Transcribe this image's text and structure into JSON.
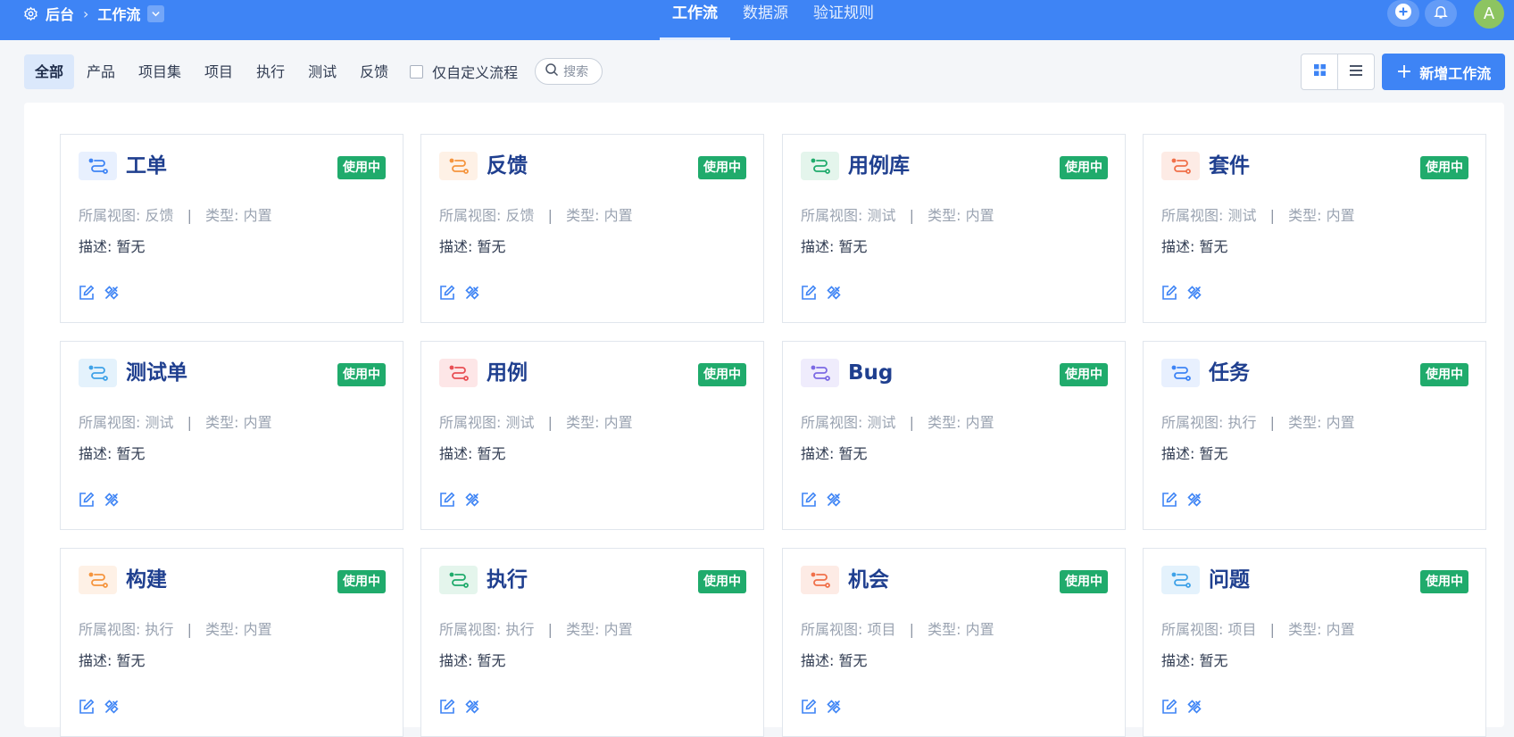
{
  "header": {
    "breadcrumb": {
      "settings_icon": "gear-icon",
      "home": "后台",
      "current": "工作流",
      "dropdown_icon": "chevron-down-icon"
    },
    "tabs": [
      {
        "label": "工作流",
        "active": true
      },
      {
        "label": "数据源",
        "active": false
      },
      {
        "label": "验证规则",
        "active": false
      }
    ],
    "avatar_initial": "A"
  },
  "filters": {
    "tabs": [
      {
        "label": "全部",
        "active": true
      },
      {
        "label": "产品",
        "active": false
      },
      {
        "label": "项目集",
        "active": false
      },
      {
        "label": "项目",
        "active": false
      },
      {
        "label": "执行",
        "active": false
      },
      {
        "label": "测试",
        "active": false
      },
      {
        "label": "反馈",
        "active": false
      }
    ],
    "custom_only_label": "仅自定义流程",
    "custom_only_checked": false,
    "search_placeholder": "搜索"
  },
  "toolbar": {
    "add_label": "新增工作流",
    "view_mode": "grid"
  },
  "labels": {
    "view_prefix": "所属视图:",
    "type_prefix": "类型:",
    "desc_prefix": "描述:"
  },
  "colors": {
    "accent": "#3e84f5",
    "badge": "#20ab6c",
    "title": "#1f3f8f"
  },
  "workflows": [
    {
      "name": "工单",
      "status": "使用中",
      "view": "反馈",
      "type": "内置",
      "desc": "暂无",
      "icon_color": "#3e84f5",
      "icon_bg": "#e8f0fe"
    },
    {
      "name": "反馈",
      "status": "使用中",
      "view": "反馈",
      "type": "内置",
      "desc": "暂无",
      "icon_color": "#f5953e",
      "icon_bg": "#fef1e6"
    },
    {
      "name": "用例库",
      "status": "使用中",
      "view": "测试",
      "type": "内置",
      "desc": "暂无",
      "icon_color": "#20ab6c",
      "icon_bg": "#e4f5ec"
    },
    {
      "name": "套件",
      "status": "使用中",
      "view": "测试",
      "type": "内置",
      "desc": "暂无",
      "icon_color": "#f0704a",
      "icon_bg": "#fdebe5"
    },
    {
      "name": "测试单",
      "status": "使用中",
      "view": "测试",
      "type": "内置",
      "desc": "暂无",
      "icon_color": "#3fa2e8",
      "icon_bg": "#e4f2fc"
    },
    {
      "name": "用例",
      "status": "使用中",
      "view": "测试",
      "type": "内置",
      "desc": "暂无",
      "icon_color": "#e84f55",
      "icon_bg": "#fde6e7"
    },
    {
      "name": "Bug",
      "status": "使用中",
      "view": "测试",
      "type": "内置",
      "desc": "暂无",
      "icon_color": "#7c6ae4",
      "icon_bg": "#efecfc"
    },
    {
      "name": "任务",
      "status": "使用中",
      "view": "执行",
      "type": "内置",
      "desc": "暂无",
      "icon_color": "#3e84f5",
      "icon_bg": "#e8f0fe"
    },
    {
      "name": "构建",
      "status": "使用中",
      "view": "执行",
      "type": "内置",
      "desc": "暂无",
      "icon_color": "#f5953e",
      "icon_bg": "#fef1e6"
    },
    {
      "name": "执行",
      "status": "使用中",
      "view": "执行",
      "type": "内置",
      "desc": "暂无",
      "icon_color": "#20ab6c",
      "icon_bg": "#e4f5ec"
    },
    {
      "name": "机会",
      "status": "使用中",
      "view": "项目",
      "type": "内置",
      "desc": "暂无",
      "icon_color": "#f0704a",
      "icon_bg": "#fdebe5"
    },
    {
      "name": "问题",
      "status": "使用中",
      "view": "项目",
      "type": "内置",
      "desc": "暂无",
      "icon_color": "#3fa2e8",
      "icon_bg": "#e4f2fc"
    }
  ]
}
